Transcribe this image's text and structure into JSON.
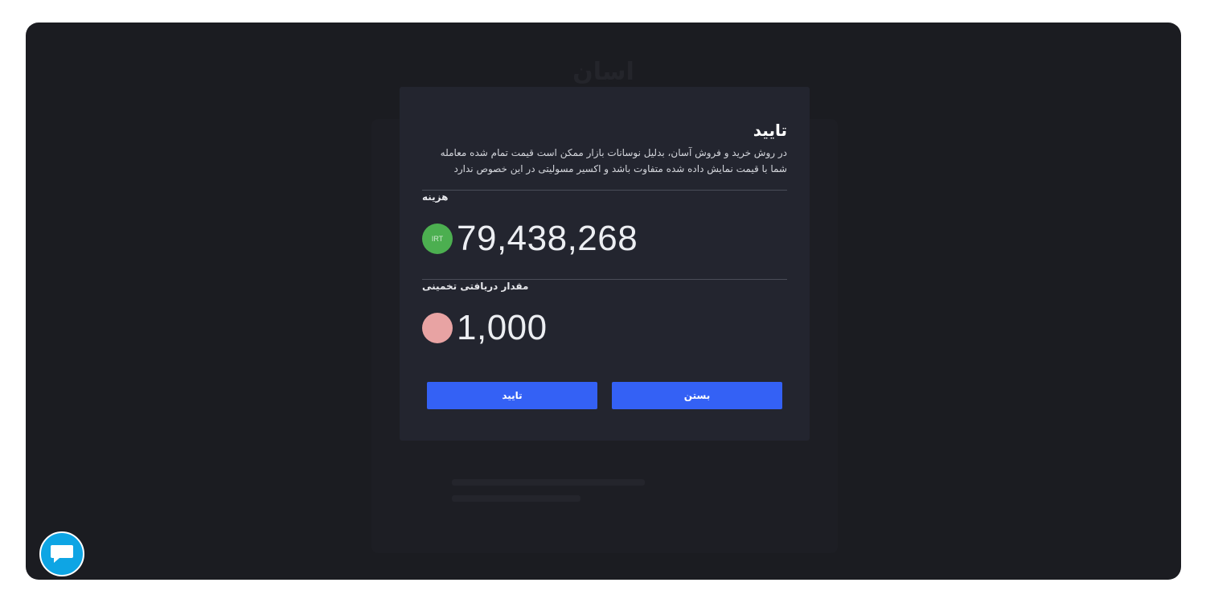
{
  "background": {
    "title": "اسان"
  },
  "modal": {
    "title": "تایید",
    "description": "در روش خرید و فروش آسان، بدلیل نوسانات بازار ممکن است قیمت تمام شده معامله شما با قیمت نمایش داده شده متفاوت باشد و اکسیر مسولیتی در این خصوص ندارد",
    "cost": {
      "label": "هزینه",
      "value": "79,438,268",
      "coin_label": "IRT",
      "coin_color": "#4caf50"
    },
    "receive": {
      "label": "مقدار دریافتی تخمینی",
      "value": "1,000",
      "coin_label": "",
      "coin_color": "#e8a3a3"
    },
    "buttons": {
      "confirm": "تایید",
      "close": "بستن"
    }
  },
  "colors": {
    "primary_button": "#3461f5",
    "chat_button": "#0ea5e4"
  },
  "icons": {
    "chat": "chat-bubble-icon"
  }
}
